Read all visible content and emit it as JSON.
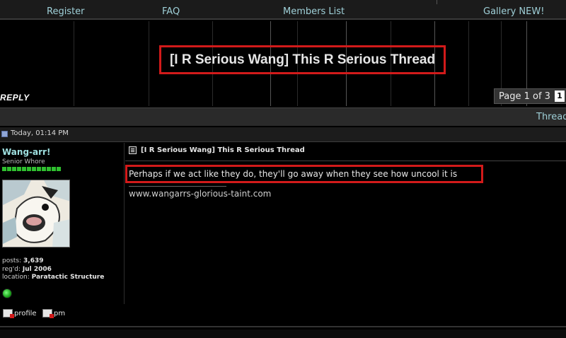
{
  "nav": {
    "links": [
      "Register",
      "FAQ",
      "Members List",
      "Gallery NEW!"
    ]
  },
  "banner": {
    "thread_title": "[I R Serious Wang] This R Serious Thread",
    "reply_label": "REPLY",
    "pager_label": "Page 1 of 3",
    "current_page": "1"
  },
  "toolbar": {
    "thread_tools_label": "Thread"
  },
  "post": {
    "date": "Today, 01:14 PM",
    "title": "[I R Serious Wang] This R Serious Thread",
    "message": "Perhaps if we act like they do, they'll go away when they see how uncool it is",
    "signature": "www.wangarrs-glorious-taint.com",
    "profile_label": "profile",
    "pm_label": "pm"
  },
  "user": {
    "name": "Wang-arr!",
    "title": "Senior Whore",
    "posts_label": "posts:",
    "posts": "3,639",
    "regd_label": "reg'd:",
    "regd": "Jul 2006",
    "location_label": "location:",
    "location": "Paratactic Structure",
    "online_status_color": "#2fbf2f"
  },
  "colors": {
    "accent_link": "#9fd0d8",
    "highlight_box": "#d21a1a",
    "background": "#000000"
  }
}
